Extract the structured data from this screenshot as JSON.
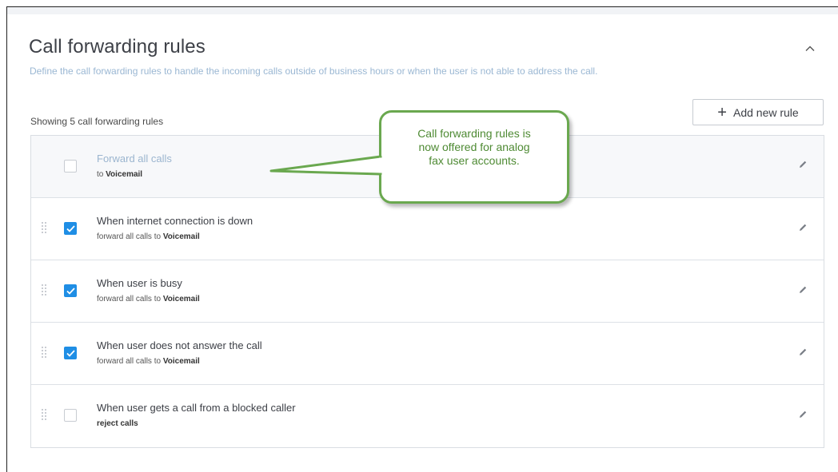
{
  "header": {
    "title": "Call forwarding rules",
    "subtitle": "Define the call forwarding rules to handle the incoming calls outside of business hours or when the user is not able to address the call."
  },
  "toolbar": {
    "showing_text": "Showing 5 call forwarding rules",
    "add_label": "Add new rule",
    "add_icon": "plus-icon"
  },
  "rules": [
    {
      "title": "Forward all calls",
      "sub_prefix": "to ",
      "sub_bold": "Voicemail",
      "checked": false,
      "draggable": false
    },
    {
      "title": "When internet connection is down",
      "sub_prefix": "forward all calls to ",
      "sub_bold": "Voicemail",
      "checked": true,
      "draggable": true
    },
    {
      "title": "When user is busy",
      "sub_prefix": "forward all calls to ",
      "sub_bold": "Voicemail",
      "checked": true,
      "draggable": true
    },
    {
      "title": "When user does not answer the call",
      "sub_prefix": "forward all calls to ",
      "sub_bold": "Voicemail",
      "checked": true,
      "draggable": true
    },
    {
      "title": "When user gets a call from a blocked caller",
      "sub_prefix": "",
      "sub_bold": "reject calls",
      "checked": false,
      "draggable": true
    }
  ],
  "callout": {
    "line1": "Call forwarding rules is",
    "line2": "now offered for analog",
    "line3": "fax user accounts."
  },
  "colors": {
    "accent": "#1f8ee5",
    "callout_border": "#6aa84f",
    "callout_text": "#4e8a33",
    "subtitle": "#9ab7d3"
  }
}
